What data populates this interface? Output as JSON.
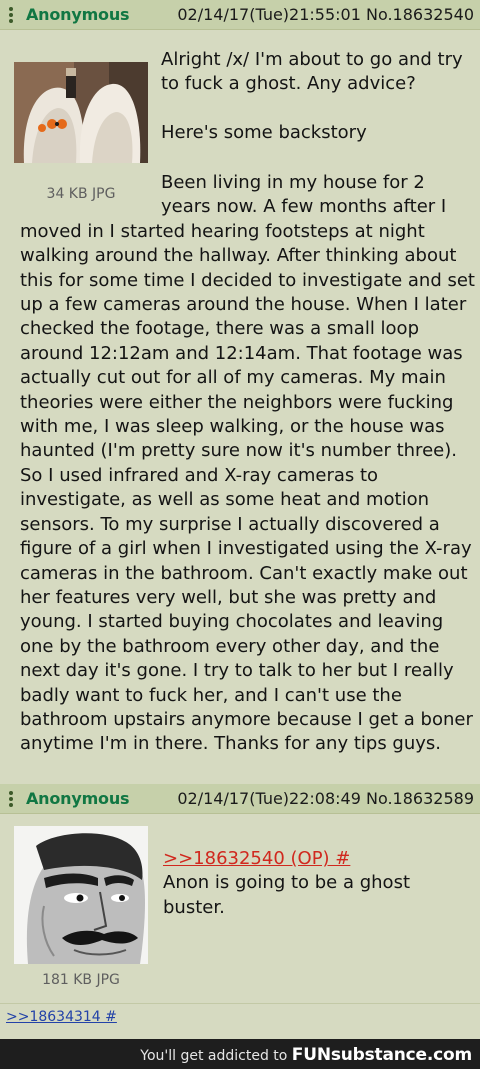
{
  "posts": [
    {
      "name": "Anonymous",
      "meta": "02/14/17(Tue)21:55:01 No.18632540",
      "file_info": "34 KB JPG",
      "paragraphs": [
        "Alright /x/ I'm about to go and try to fuck a ghost. Any advice?",
        "Here's some backstory",
        "Been living in my house for 2 years now. A few months after I moved in I started hearing footsteps at night walking around the hallway. After thinking about this for some time I decided to investigate and set up a few cameras around the house. When I later checked the footage, there was a small loop around 12:12am and 12:14am. That footage was actually cut out for all of my cameras. My main theories were either the neighbors were fucking with me, I was sleep walking, or the house was haunted (I'm pretty sure now it's number three). So I used infrared and X-ray cameras to investigate, as well as some heat and motion sensors. To my surprise I actually discovered a figure of a girl when I investigated using the X-ray cameras in the bathroom. Can't exactly make out her features very well, but she was pretty and young. I started buying chocolates and leaving one by the bathroom every other day, and the next day it's gone. I try to talk to her but I really badly want to fuck her, and I can't use the bathroom upstairs anymore because I get a boner anytime I'm in there. Thanks for any tips guys."
      ]
    },
    {
      "name": "Anonymous",
      "meta": "02/14/17(Tue)22:08:49 No.18632589",
      "file_info": "181 KB JPG",
      "quote_link": ">>18632540 (OP) #",
      "text": "Anon is going to be a ghost buster."
    }
  ],
  "backlink": ">>18634314 #",
  "watermark": {
    "prefix": "You'll get addicted to",
    "brand": "FUNsubstance.com"
  },
  "colors": {
    "post_bg": "#d6dac1",
    "header_bg": "#c6d0aa",
    "name": "#117743",
    "quote_link": "#d0281e",
    "backlink": "#2342a8"
  },
  "icons": [
    "menu-dots-icon"
  ]
}
